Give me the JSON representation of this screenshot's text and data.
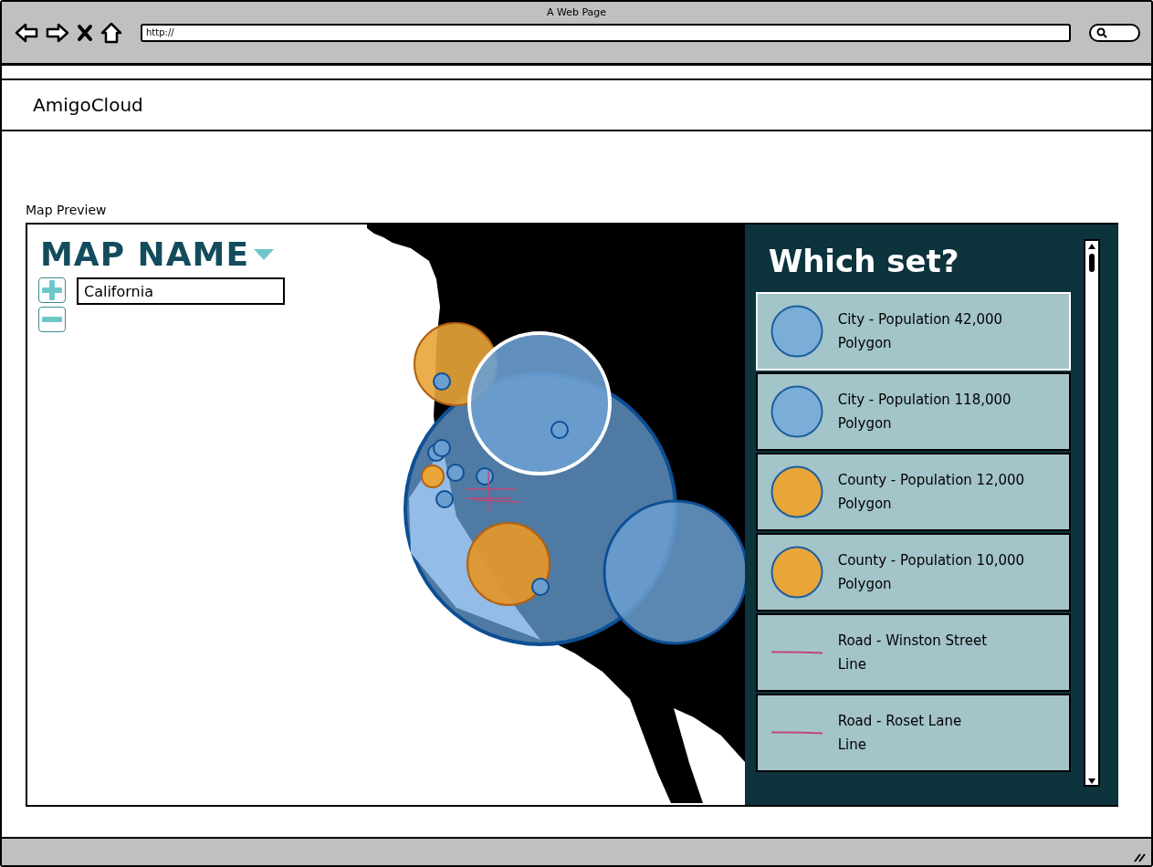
{
  "browser": {
    "title": "A Web Page",
    "url": "http://"
  },
  "site": {
    "brand": "AmigoCloud"
  },
  "section_label": "Map Preview",
  "map": {
    "name": "MAP NAME",
    "search_value": "California"
  },
  "panel": {
    "title": "Which set?",
    "layers": [
      {
        "kind": "polygon",
        "color": "#7aaed6",
        "title": "City - Population 42,000",
        "type": "Polygon",
        "selected": true
      },
      {
        "kind": "polygon",
        "color": "#7aaed6",
        "title": "City - Population 118,000",
        "type": "Polygon",
        "selected": false
      },
      {
        "kind": "polygon",
        "color": "#e9a538",
        "title": "County - Population 12,000",
        "type": "Polygon",
        "selected": false
      },
      {
        "kind": "polygon",
        "color": "#e9a538",
        "title": "County - Population 10,000",
        "type": "Polygon",
        "selected": false
      },
      {
        "kind": "line",
        "color": "#c0467a",
        "title": "Road - Winston Street",
        "type": "Line",
        "selected": false
      },
      {
        "kind": "line",
        "color": "#c0467a",
        "title": "Road - Roset Lane",
        "type": "Line",
        "selected": false
      }
    ]
  }
}
